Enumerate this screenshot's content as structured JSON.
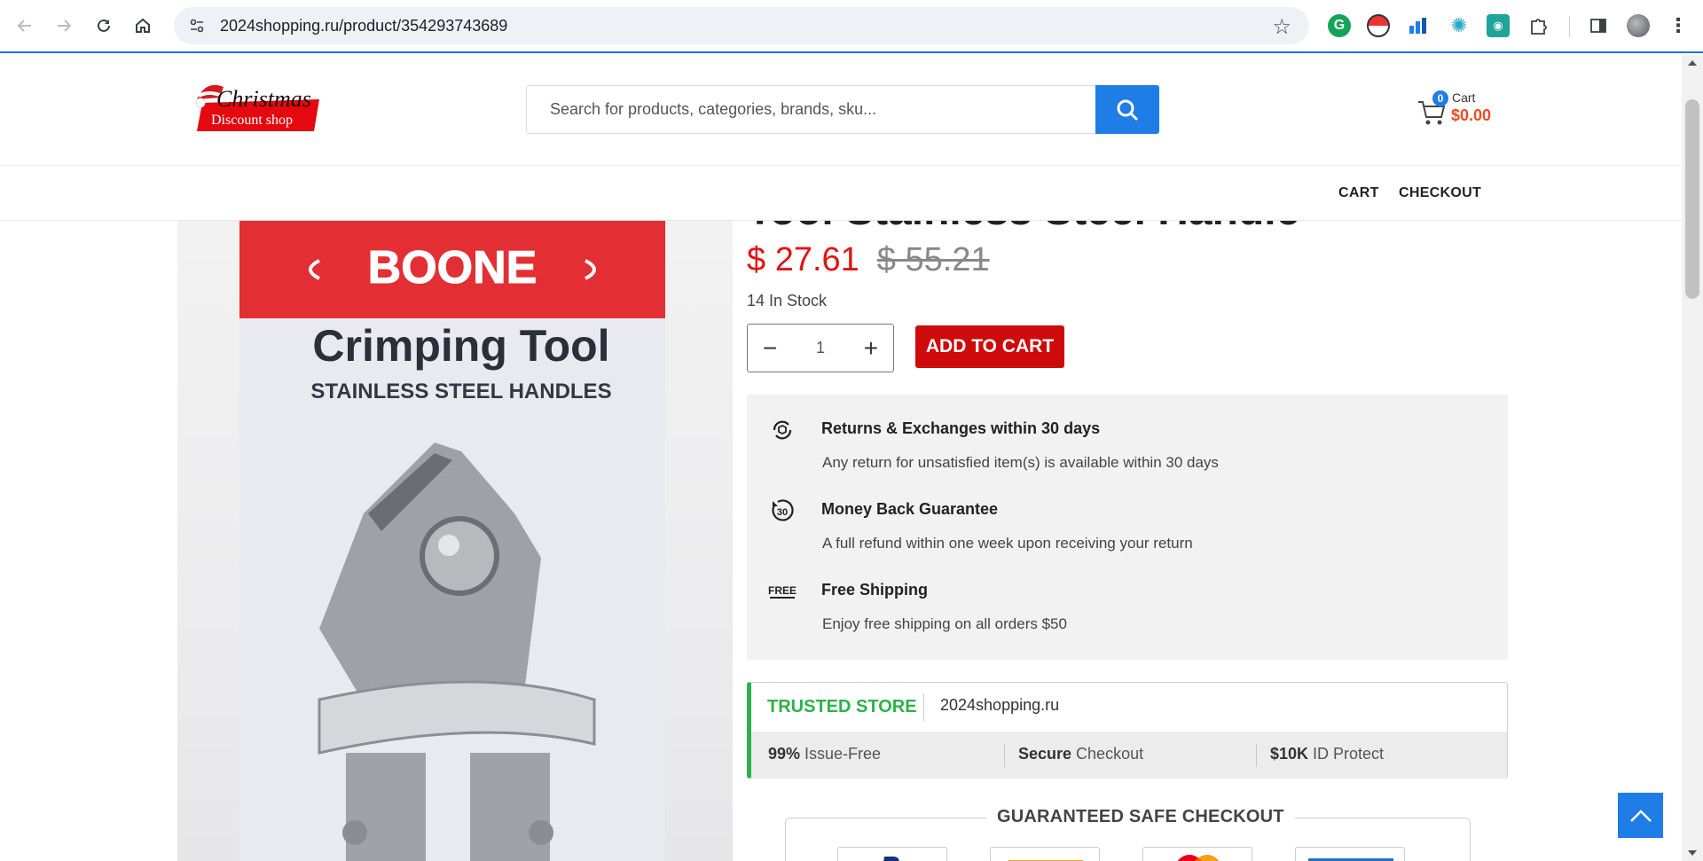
{
  "browser": {
    "url": "2024shopping.ru/product/354293743689"
  },
  "header": {
    "logo_top": "Christmas",
    "logo_bottom": "Discount shop",
    "search_placeholder": "Search for products, categories, brands, sku...",
    "cart_count": "0",
    "cart_label": "Cart",
    "cart_total": "$0.00"
  },
  "nav": {
    "cart": "CART",
    "checkout": "CHECKOUT"
  },
  "product": {
    "title_peek": "Tool Stainless Steel Handle",
    "image_brand": "BOONE",
    "image_title": "Crimping Tool",
    "image_subtitle": "STAINLESS STEEL HANDLES",
    "price": "$ 27.61",
    "old_price": "$ 55.21",
    "stock": "14 In Stock",
    "quantity": "1",
    "add_to_cart": "ADD TO CART"
  },
  "benefits": [
    {
      "icon": "returns-icon",
      "title": "Returns & Exchanges within 30 days",
      "desc": "Any return for unsatisfied item(s) is available within 30 days"
    },
    {
      "icon": "money-back-30-icon",
      "title": "Money Back Guarantee",
      "desc": "A full refund within one week upon receiving your return"
    },
    {
      "icon": "free-shipping-icon",
      "title": "Free Shipping",
      "desc": "Enjoy free shipping on all orders $50"
    }
  ],
  "trusted": {
    "badge": "TRUSTED STORE",
    "domain": "2024shopping.ru",
    "stat1_bold": "99%",
    "stat1_text": " Issue-Free",
    "stat2_bold": "Secure",
    "stat2_text": " Checkout",
    "stat3_bold": "$10K",
    "stat3_text": " ID Protect"
  },
  "safe_checkout": {
    "title": "GUARANTEED SAFE CHECKOUT",
    "cards": [
      "paypal",
      "visa",
      "mastercard",
      "american-express"
    ]
  },
  "colors": {
    "accent": "#1e7de7",
    "price": "#e31414",
    "add_to_cart": "#cf0a0a",
    "trusted_green": "#2bb34a",
    "cart_total": "#ef4b22"
  }
}
